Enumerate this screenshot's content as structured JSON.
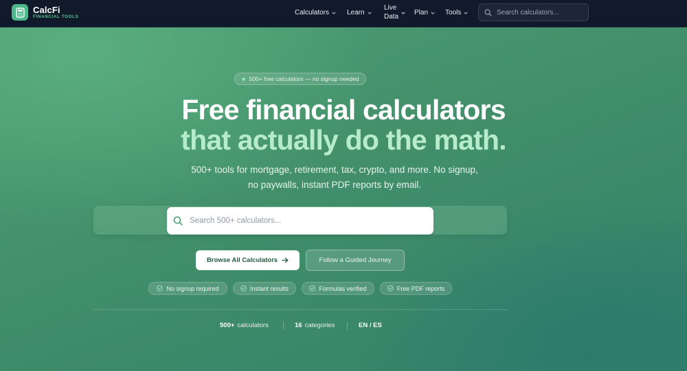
{
  "brand": {
    "name": "CalcFi",
    "subtitle": "FINANCIAL TOOLS",
    "logo_icon": "calculator-icon",
    "accent": "#4fb88a"
  },
  "nav": {
    "items": [
      {
        "label": "Calculators",
        "icon": "chevron-down-icon"
      },
      {
        "label": "Learn",
        "icon": "chevron-down-icon"
      },
      {
        "label_line1": "Live",
        "label_line2": "Data",
        "icon": "chevron-down-icon"
      },
      {
        "label": "Plan",
        "icon": "chevron-down-icon"
      },
      {
        "label": "Tools",
        "icon": "chevron-down-icon"
      }
    ],
    "search": {
      "placeholder": "Search calculators...",
      "value": "",
      "icon": "search-icon"
    },
    "background": "#111a2b"
  },
  "hero": {
    "pill": "500+ free calculators — no signup needed",
    "headline_line1": "Free financial calculators",
    "headline_line2": "that actually do the math.",
    "subtitle_line1": "500+ tools for mortgage, retirement, tax, crypto, and more. No signup,",
    "subtitle_line2": "no paywalls, instant PDF reports by email.",
    "search": {
      "placeholder": "Search 500+ calculators...",
      "value": "",
      "icon": "search-icon"
    },
    "primary_button": {
      "label": "Browse All Calculators",
      "icon": "arrow-right-icon"
    },
    "secondary_button": {
      "label": "Follow a Guided Journey"
    },
    "badges": [
      {
        "label": "No signup required",
        "icon": "check-circle-icon"
      },
      {
        "label": "Instant results",
        "icon": "check-circle-icon"
      },
      {
        "label": "Formulas verified",
        "icon": "check-circle-icon"
      },
      {
        "label": "Free PDF reports",
        "icon": "check-circle-icon"
      }
    ],
    "stats": [
      {
        "value": "500+",
        "label": "calculators"
      },
      {
        "value": "16",
        "label": "categories"
      },
      {
        "value": "EN / ES",
        "label": ""
      }
    ],
    "headline_accent": "#b6ecc9",
    "background": "#3d8f68"
  }
}
